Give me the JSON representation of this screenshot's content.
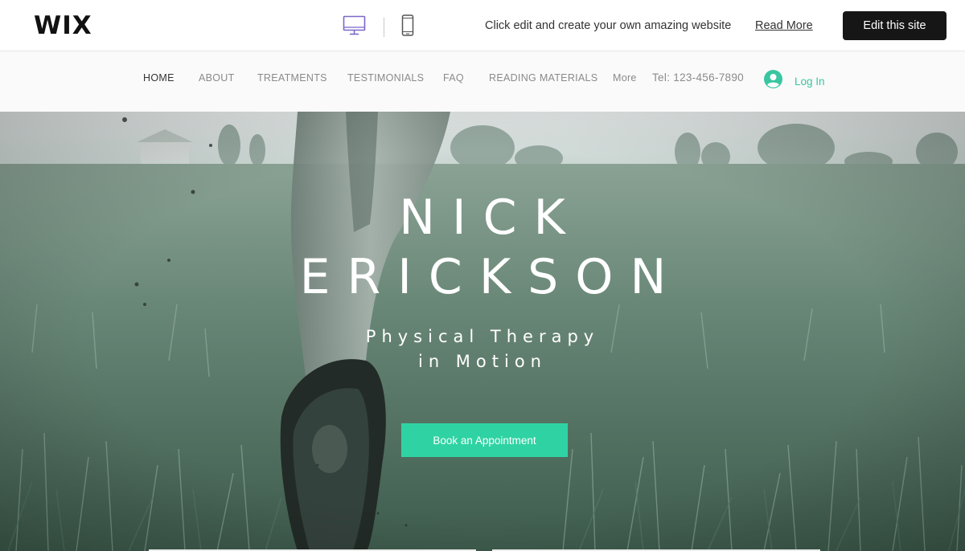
{
  "wix_bar": {
    "logo": "WIX",
    "desktop_icon": "desktop-icon",
    "mobile_icon": "mobile-phone-icon",
    "promo_text": "Click edit and create your own amazing website",
    "read_more": "Read More",
    "edit_button": "Edit this site"
  },
  "nav": {
    "items": [
      {
        "label": "HOME",
        "active": true
      },
      {
        "label": "ABOUT",
        "active": false
      },
      {
        "label": "TREATMENTS",
        "active": false
      },
      {
        "label": "TESTIMONIALS",
        "active": false
      },
      {
        "label": "FAQ",
        "active": false
      },
      {
        "label": "READING MATERIALS",
        "active": false
      },
      {
        "label": "More",
        "active": false
      }
    ],
    "phone": "Tel: 123-456-7890",
    "login": "Log In",
    "login_icon": "user-avatar-icon"
  },
  "hero": {
    "title_line1": "NICK",
    "title_line2": "ERICKSON",
    "subtitle_line1": "Physical Therapy",
    "subtitle_line2": "in Motion",
    "cta": "Book an Appointment"
  },
  "colors": {
    "accent": "#2fd3a3",
    "login_text": "#39c6a0",
    "dark_button": "#161616",
    "desktop_icon_active": "#7b68c8"
  }
}
